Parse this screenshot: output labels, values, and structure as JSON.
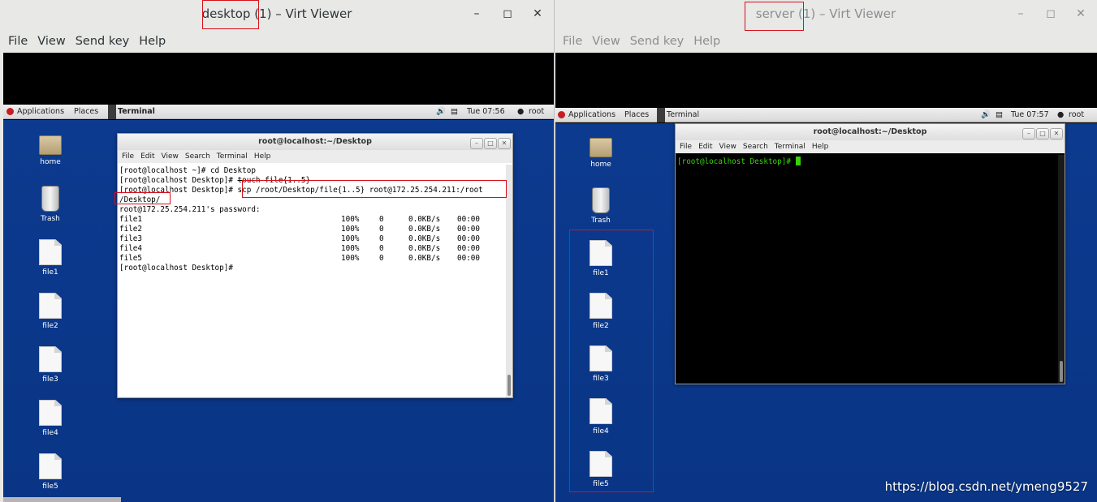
{
  "left": {
    "title": "desktop (1) – Virt Viewer",
    "menu": [
      "File",
      "View",
      "Send key",
      "Help"
    ],
    "topbar": {
      "applications": "Applications",
      "places": "Places",
      "terminal": "Terminal",
      "clock": "Tue 07:56",
      "user": "root"
    },
    "desktop_icons": [
      "home",
      "Trash",
      "file1",
      "file2",
      "file3",
      "file4",
      "file5"
    ],
    "terminal": {
      "title": "root@localhost:~/Desktop",
      "menu": [
        "File",
        "Edit",
        "View",
        "Search",
        "Terminal",
        "Help"
      ],
      "lines": {
        "l1": "[root@localhost ~]# cd Desktop",
        "l2_prompt": "[root@localhost Desktop]# ",
        "l2_cmd": "touch file{1..5}",
        "l3_prompt": "[root@localhost Desktop]# ",
        "l3_cmd": "scp /root/Desktop/file{1..5} root@172.25.254.211:/root",
        "l4": "/Desktop/",
        "l5": "root@172.25.254.211's password:",
        "l11": "[root@localhost Desktop]# "
      },
      "transfers": [
        {
          "name": "file1",
          "pct": "100%",
          "size": "0",
          "rate": "0.0KB/s",
          "time": "00:00"
        },
        {
          "name": "file2",
          "pct": "100%",
          "size": "0",
          "rate": "0.0KB/s",
          "time": "00:00"
        },
        {
          "name": "file3",
          "pct": "100%",
          "size": "0",
          "rate": "0.0KB/s",
          "time": "00:00"
        },
        {
          "name": "file4",
          "pct": "100%",
          "size": "0",
          "rate": "0.0KB/s",
          "time": "00:00"
        },
        {
          "name": "file5",
          "pct": "100%",
          "size": "0",
          "rate": "0.0KB/s",
          "time": "00:00"
        }
      ]
    }
  },
  "right": {
    "title": "server (1) – Virt Viewer",
    "menu": [
      "File",
      "View",
      "Send key",
      "Help"
    ],
    "topbar": {
      "applications": "Applications",
      "places": "Places",
      "terminal": "Terminal",
      "clock": "Tue 07:57",
      "user": "root"
    },
    "desktop_icons": [
      "home",
      "Trash",
      "file1",
      "file2",
      "file3",
      "file4",
      "file5"
    ],
    "terminal": {
      "title": "root@localhost:~/Desktop",
      "menu": [
        "File",
        "Edit",
        "View",
        "Search",
        "Terminal",
        "Help"
      ],
      "prompt": "[root@localhost Desktop]# "
    }
  },
  "watermark": "https://blog.csdn.net/ymeng9527",
  "colors": {
    "desktop_bg": "#0c3a8e",
    "highlight": "#d6111a",
    "prompt_green": "#39d10a"
  }
}
